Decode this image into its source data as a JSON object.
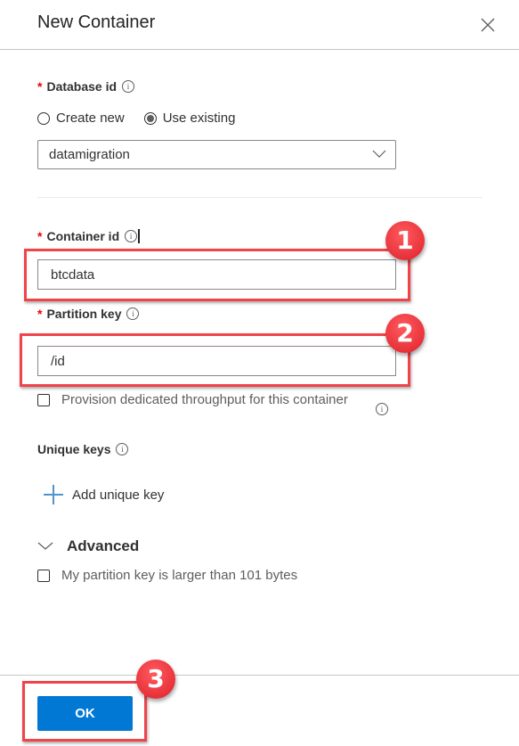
{
  "header": {
    "title": "New Container",
    "close_icon": "close-icon"
  },
  "database": {
    "label": "Database id",
    "required_mark": "*",
    "info_glyph": "i",
    "options": [
      {
        "label": "Create new",
        "selected": false
      },
      {
        "label": "Use existing",
        "selected": true
      }
    ],
    "selected_value": "datamigration"
  },
  "container": {
    "label": "Container id",
    "required_mark": "*",
    "info_glyph": "i",
    "value": "btcdata"
  },
  "partition": {
    "label": "Partition key",
    "required_mark": "*",
    "info_glyph": "i",
    "value": "/id"
  },
  "throughput": {
    "label": "Provision dedicated throughput for this container",
    "checked": false,
    "info_glyph": "i"
  },
  "unique_keys": {
    "label": "Unique keys",
    "info_glyph": "i",
    "add_label": "Add unique key"
  },
  "advanced": {
    "label": "Advanced",
    "large_key_label": "My partition key is larger than 101 bytes",
    "checked": false
  },
  "footer": {
    "ok_label": "OK"
  },
  "annotations": {
    "badge1": "1",
    "badge2": "2",
    "badge3": "3",
    "highlight_color": "#f0434a"
  }
}
